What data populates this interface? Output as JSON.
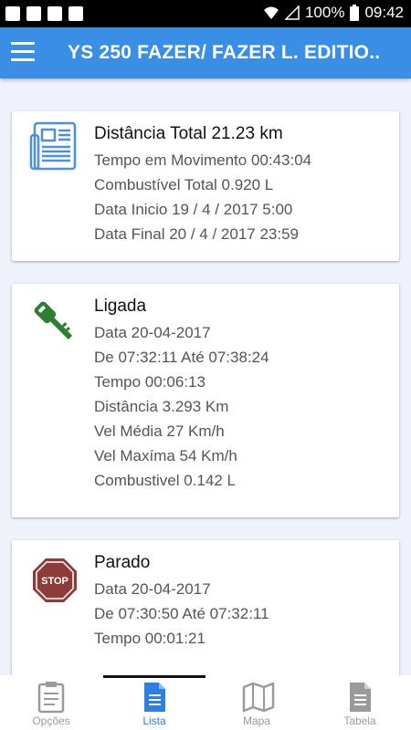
{
  "status_bar": {
    "battery": "100%",
    "time": "09:42"
  },
  "app_bar": {
    "title": "YS 250 FAZER/ FAZER L. EDITIO.."
  },
  "cards": [
    {
      "icon": "newspaper-icon",
      "header": "Distância Total 21.23 km",
      "lines": [
        "Tempo em Movimento 00:43:04",
        "Combustível Total 0.920 L",
        "Data Inicio 19 / 4 / 2017 5:00",
        "Data Final 20 / 4 / 2017 23:59"
      ]
    },
    {
      "icon": "key-icon",
      "header": "Ligada",
      "lines": [
        "Data 20-04-2017",
        "De 07:32:11 Até 07:38:24",
        "Tempo 00:06:13",
        "Distância 3.293 Km",
        "Vel Média 27 Km/h",
        "Vel Maxíma 54 Km/h",
        "Combustivel 0.142 L"
      ]
    },
    {
      "icon": "stop-sign-icon",
      "stop_label": "STOP",
      "header": "Parado",
      "lines": [
        "Data 20-04-2017",
        "De 07:30:50 Até 07:32:11",
        "Tempo 00:01:21"
      ]
    }
  ],
  "bottom_nav": {
    "tabs": [
      {
        "label": "Opções",
        "icon": "clipboard-icon",
        "active": false
      },
      {
        "label": "Lista",
        "icon": "document-icon",
        "active": true
      },
      {
        "label": "Mapa",
        "icon": "map-icon",
        "active": false
      },
      {
        "label": "Tabela",
        "icon": "document-icon",
        "active": false
      }
    ]
  },
  "colors": {
    "app_bar": "#3a8ee6",
    "active_tab": "#2d7fe3",
    "key_icon": "#2e7d32",
    "stop_sign": "#8e3b3b",
    "newspaper_icon": "#4a8fe0"
  }
}
